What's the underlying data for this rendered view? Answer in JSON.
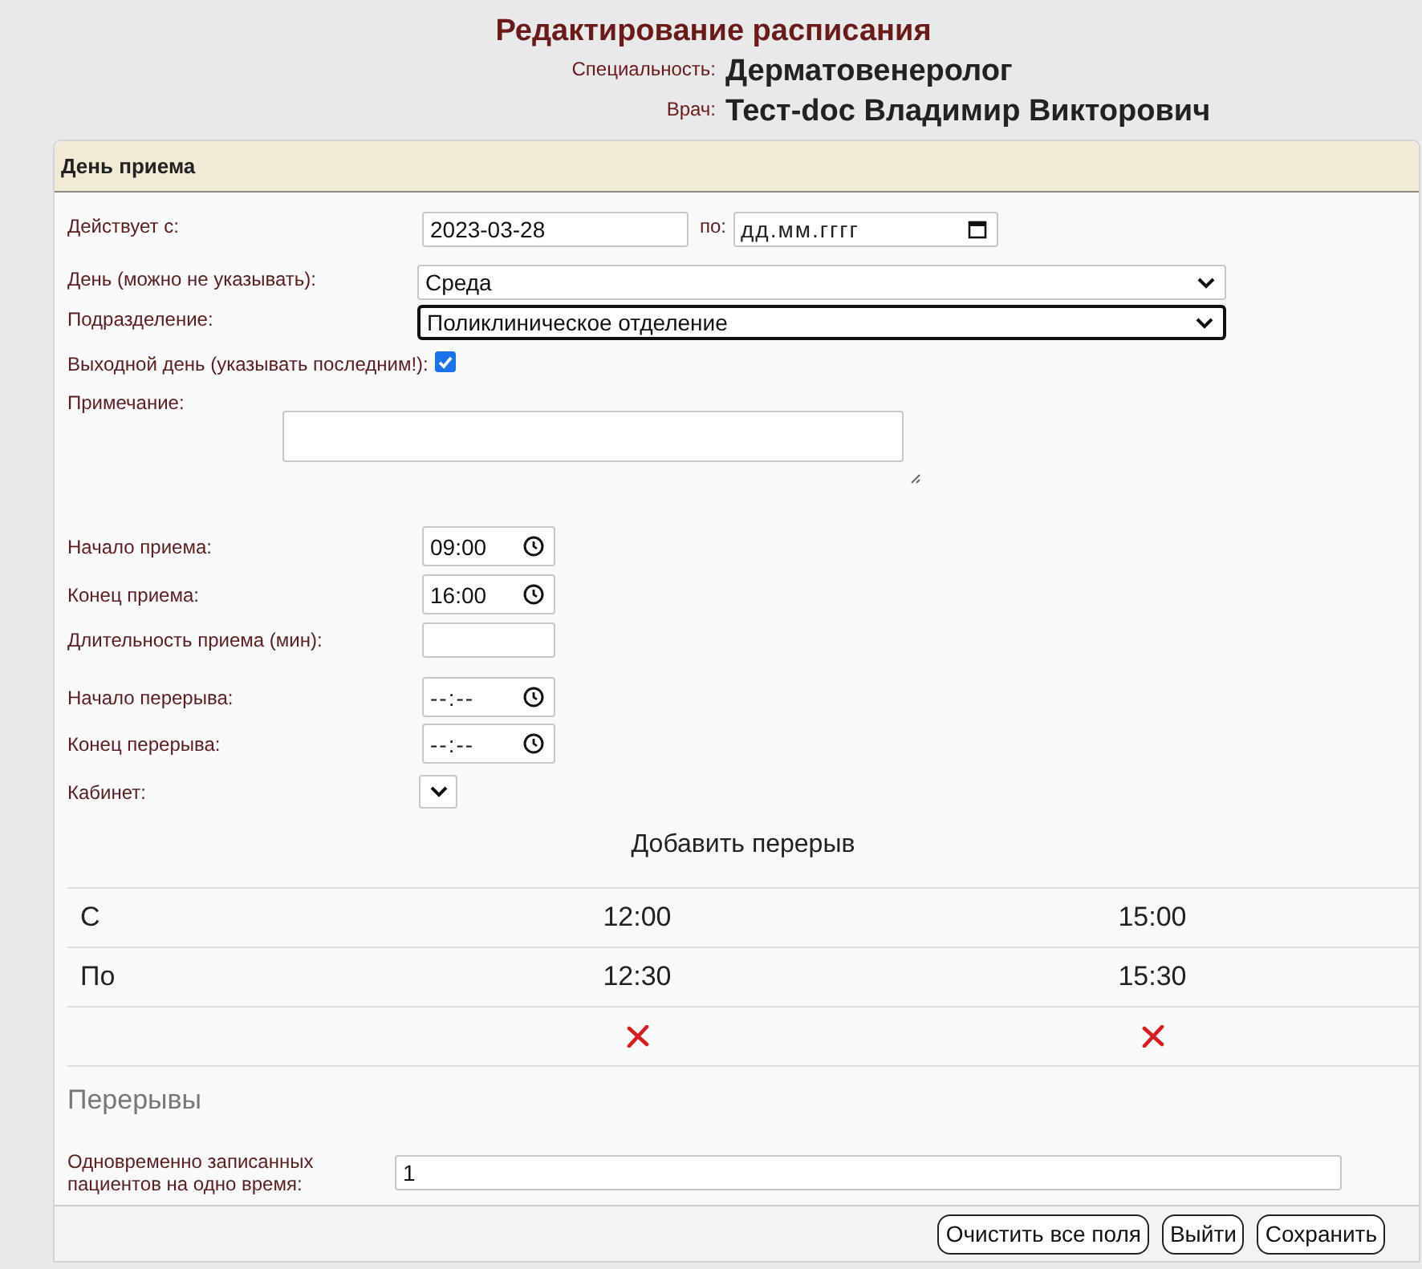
{
  "header": {
    "title": "Редактирование расписания",
    "specialty": {
      "label": "Специальность:",
      "value": "Дерматовенеролог"
    },
    "doctor": {
      "label": "Врач:",
      "value": "Тест-doc Владимир Викторович"
    }
  },
  "panel": {
    "title": "День приема"
  },
  "valid": {
    "label": "Действует с:",
    "from": "2023-03-28",
    "to_label": "по:",
    "to_placeholder": "дд.мм.гггг"
  },
  "fields": [
    {
      "kind": "select",
      "label": "День (можно не указывать):",
      "value": "Среда",
      "focused": false
    },
    {
      "kind": "select",
      "label": "Подразделение:",
      "value": "Поликлиническое отделение",
      "focused": true
    },
    {
      "kind": "checkbox",
      "label": "Выходной день (указывать последним!):",
      "checked": true
    },
    {
      "kind": "textarea",
      "label": "Примечание:"
    },
    {
      "kind": "time",
      "label": "Начало приема:",
      "value": "09:00"
    },
    {
      "kind": "time",
      "label": "Конец приема:",
      "value": "16:00"
    },
    {
      "kind": "text",
      "label": "Длительность приема (мин):"
    },
    {
      "kind": "time",
      "label": "Начало перерыва:",
      "placeholder": "--:--"
    },
    {
      "kind": "time",
      "label": "Конец перерыва:",
      "placeholder": "--:--"
    },
    {
      "kind": "small-select",
      "label": "Кабинет:"
    }
  ],
  "add_break": "Добавить перерыв",
  "breaks": {
    "rows": [
      {
        "label": "С",
        "values": [
          "12:00",
          "15:00"
        ]
      },
      {
        "label": "По",
        "values": [
          "12:30",
          "15:30"
        ]
      }
    ],
    "title": "Перерывы"
  },
  "simultaneous": {
    "label": "Одновременно записанных пациентов на одно время:",
    "value": "1"
  },
  "buttons": [
    "Очистить все поля",
    "Выйти",
    "Сохранить"
  ]
}
